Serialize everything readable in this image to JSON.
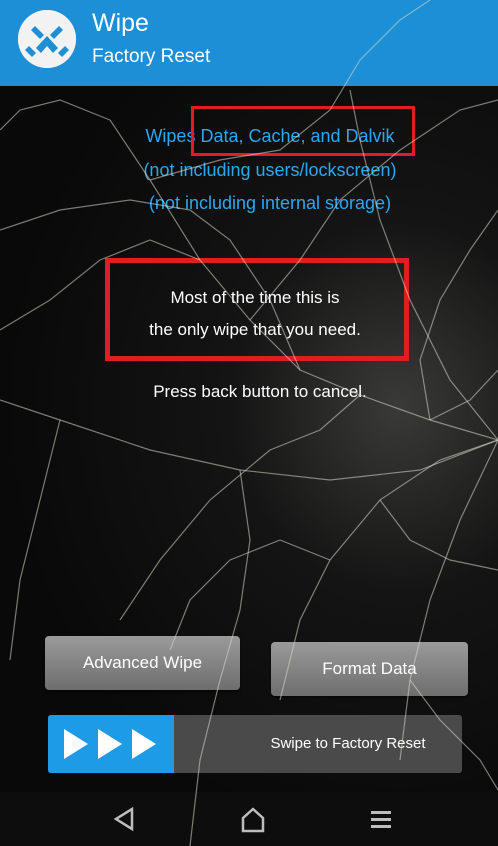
{
  "header": {
    "title": "Wipe",
    "subtitle": "Factory Reset",
    "logo_icon": "twrp-logo-icon"
  },
  "info": {
    "line1": "Wipes Data, Cache, and Dalvik",
    "line2": "(not including users/lockscreen)",
    "line3": "(not including internal storage)"
  },
  "note": {
    "line1": "Most of the time this is",
    "line2": "the only wipe that you need."
  },
  "cancel_hint": "Press back button to cancel.",
  "buttons": {
    "advanced_wipe": "Advanced Wipe",
    "format_data": "Format Data"
  },
  "swipe": {
    "label": "Swipe to Factory Reset",
    "handle_icon": "triple-arrow-icon"
  },
  "navbar": {
    "back_icon": "back-triangle-icon",
    "home_icon": "home-icon",
    "menu_icon": "menu-icon"
  },
  "colors": {
    "header_bg": "#1c8fd6",
    "info_text": "#2ca8f0",
    "highlight": "#e21c24",
    "button_bg": "#8a8a8a",
    "swipe_handle": "#1d9be6"
  }
}
